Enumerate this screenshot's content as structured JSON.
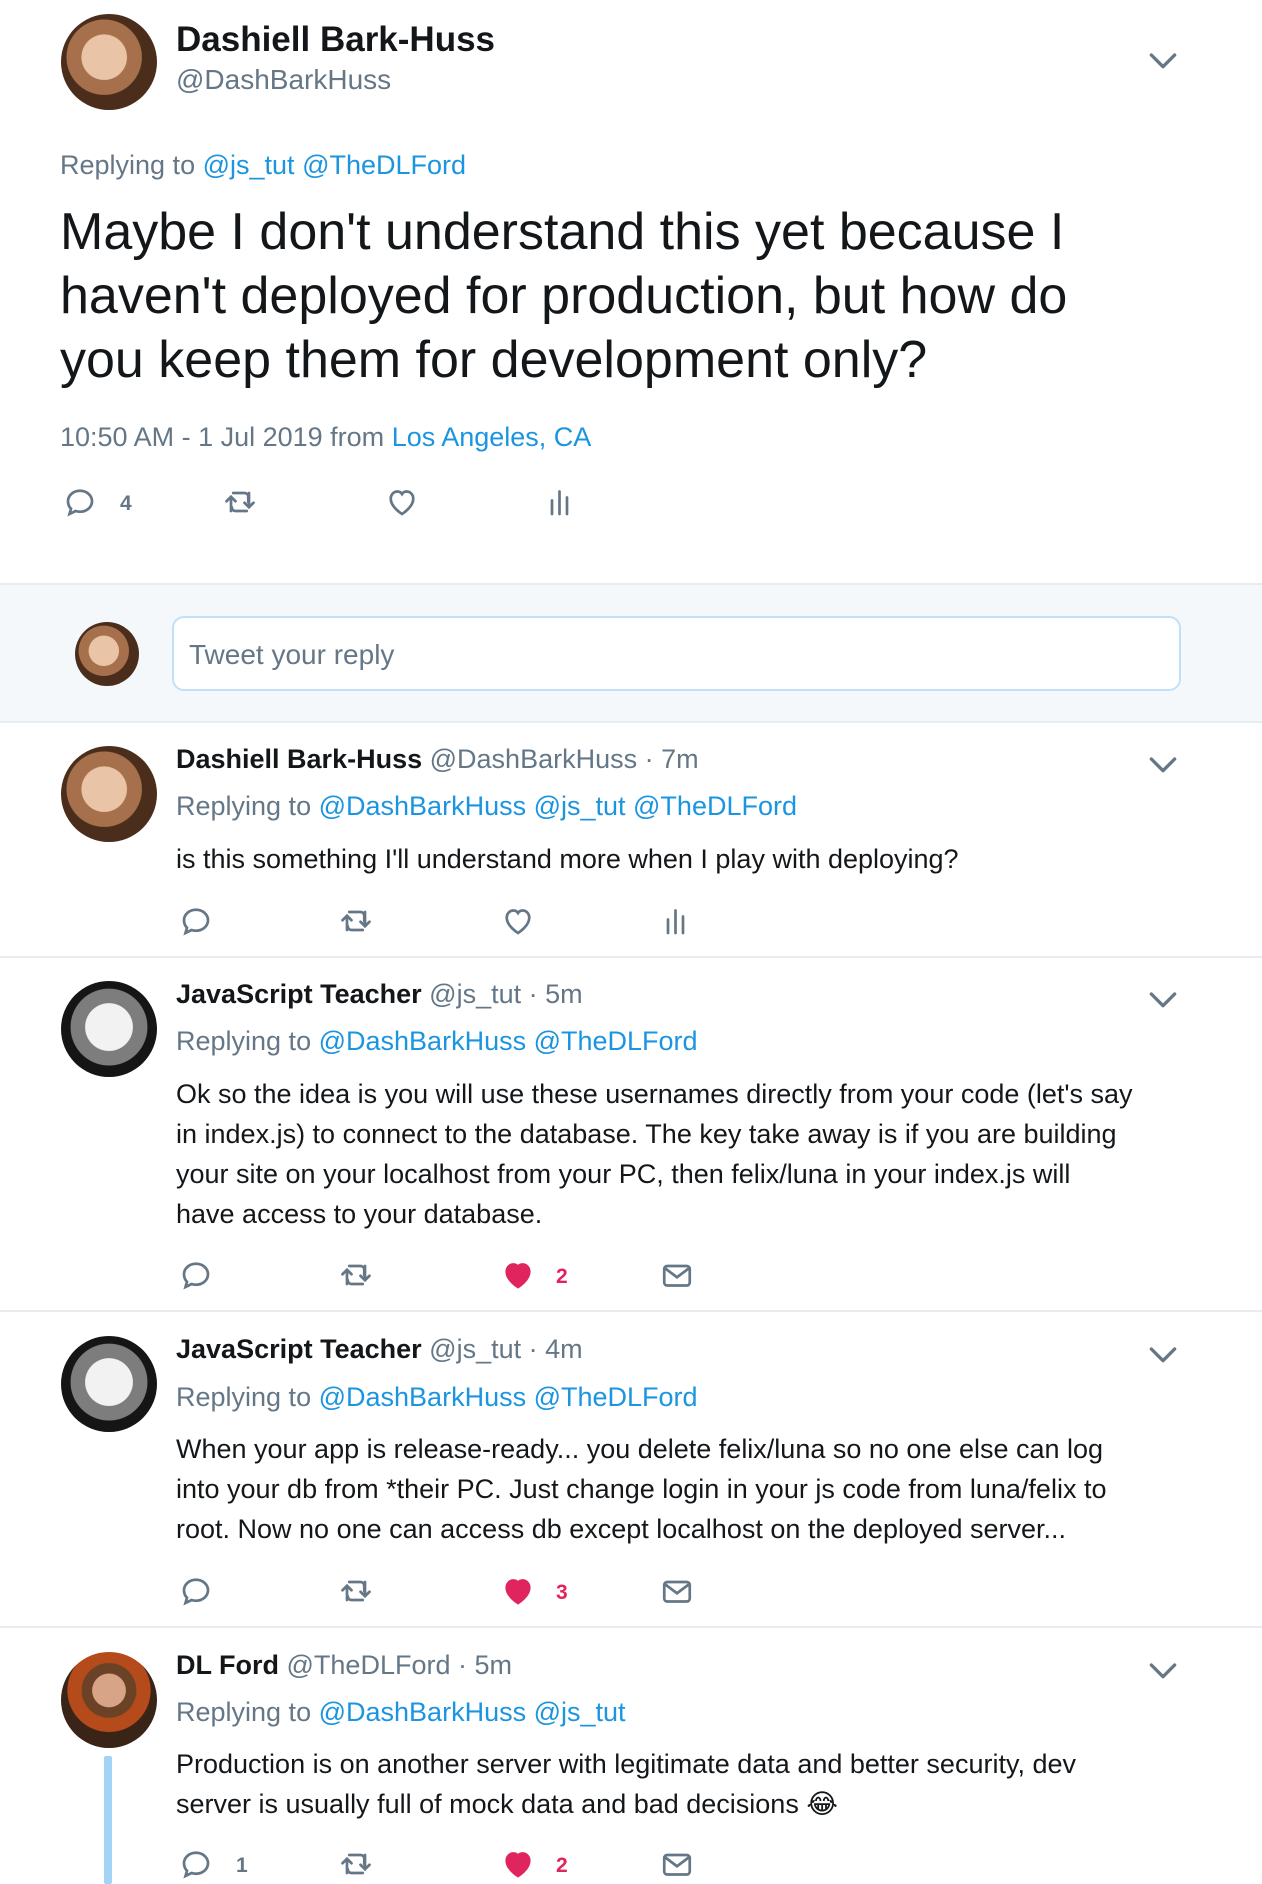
{
  "main_tweet": {
    "author_name": "Dashiell Bark-Huss",
    "author_handle": "@DashBarkHuss",
    "replying_prefix": "Replying to",
    "replying_to": [
      "@js_tut",
      "@TheDLFord"
    ],
    "text_lines": [
      "Maybe I don't understand this yet because I",
      "haven't deployed for production, but how do",
      "you keep them for development only?"
    ],
    "timestamp": "10:50 AM - 1 Jul 2019 from",
    "location": "Los Angeles, CA",
    "reply_count": "4"
  },
  "reply_box": {
    "placeholder": "Tweet your reply"
  },
  "replies": [
    {
      "author_name": "Dashiell Bark-Huss",
      "meta": "@DashBarkHuss · 7m",
      "replying_prefix": "Replying to",
      "replying_to": "@DashBarkHuss @js_tut @TheDLFord",
      "lines": [
        "is this something I'll understand more when I play with deploying?"
      ]
    },
    {
      "author_name": "JavaScript Teacher",
      "meta": "@js_tut · 5m",
      "replying_prefix": "Replying to",
      "replying_to": "@DashBarkHuss @TheDLFord",
      "lines": [
        "Ok so the idea is you will use these usernames directly from your code (let's say",
        "in index.js) to connect to the database. The key take away is if you are building",
        "your site on your localhost from your PC, then felix/luna in your index.js will",
        "have access to your database."
      ],
      "like_count": "2"
    },
    {
      "author_name": "JavaScript Teacher",
      "meta": "@js_tut · 4m",
      "replying_prefix": "Replying to",
      "replying_to": "@DashBarkHuss @TheDLFord",
      "lines": [
        "When your app is release-ready... you delete felix/luna so no one else can log",
        "into your db from *their PC. Just change login in your js code from luna/felix to",
        "root. Now no one can access db except localhost on the deployed server..."
      ],
      "like_count": "3"
    },
    {
      "author_name": "DL Ford",
      "meta": "@TheDLFord · 5m",
      "replying_prefix": "Replying to",
      "replying_to": "@DashBarkHuss @js_tut",
      "lines": [
        "Production is on another server with legitimate data and better security, dev",
        "server is usually full of mock data and bad decisions 😂"
      ],
      "reply_count": "1",
      "like_count": "2"
    }
  ],
  "colors": {
    "link": "#1b95e0",
    "muted": "#657786",
    "like_active": "#e0245e",
    "reply_box_bg": "#f5f8fa",
    "thread_line": "#a3d3f5"
  },
  "icons": [
    "chevron-down-icon",
    "reply-icon",
    "retweet-icon",
    "heart-icon",
    "analytics-icon",
    "envelope-icon"
  ]
}
